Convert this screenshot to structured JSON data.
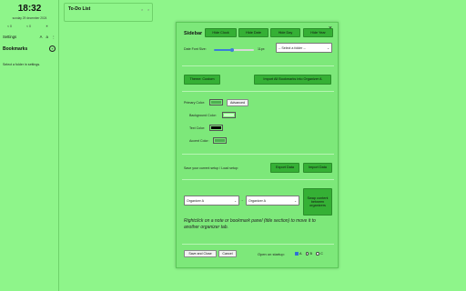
{
  "sidebar": {
    "clock": "18:32",
    "date": "sunday 29 december 2024",
    "weather": [
      "< 0",
      "< 0",
      "☀"
    ],
    "settings_label": "Settings",
    "bookmarks_label": "Bookmarks",
    "select_folder_text": "Select a folder in settings."
  },
  "todo": {
    "title": "To-Do List",
    "controls": [
      "×",
      "×"
    ]
  },
  "modal": {
    "title": "Sidebar",
    "close": "×",
    "hide_buttons": [
      "Hide Clock",
      "Hide Date",
      "Hide Day",
      "Hide Year"
    ],
    "date_font_size_label": "Date Font Size:",
    "date_font_size_value": "11px",
    "folder_select": "-- Select a folder --",
    "theme_button": "Theme: Custom",
    "import_bookmarks_button": "Import All Bookmarks into Organizer A",
    "primary_color_label": "Primary Color:",
    "advanced_button": "Advanced",
    "background_color_label": "Background Color:",
    "text_color_label": "Text Color:",
    "accent_color_label": "Accent Color:",
    "save_setup_label": "Save your current setup / Load setup:",
    "export_button": "Export Data",
    "import_button": "Import Data",
    "organizer_left": "Organizer A",
    "organizer_right": "Organizer A",
    "arrow": "→",
    "swap_button": "Swap content between organizers",
    "hint": "Rightclick on a note or bookmark panel (title section) to move it to another organizer tab.",
    "save_close_button": "Save and Close",
    "cancel_button": "Cancel",
    "open_on_startup_label": "Open on startup:",
    "startup_options": [
      "A",
      "B",
      "C"
    ]
  },
  "colors": {
    "primary": "#4caf50",
    "background": "#c8ffc4",
    "text": "#000000",
    "accent": "#4caf50",
    "page_bg": "#8ef58a"
  },
  "values": {
    "date_font_size_fraction": 0.45,
    "startup_selected": "A"
  }
}
